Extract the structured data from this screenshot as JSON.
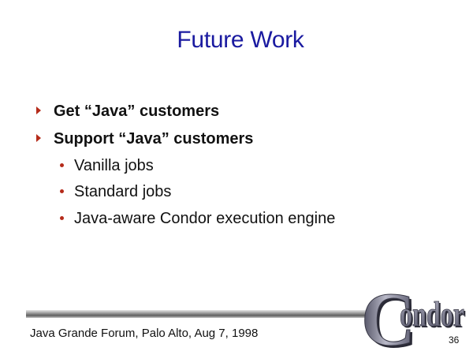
{
  "slide": {
    "title": "Future Work",
    "bullets": [
      {
        "text": "Get “Java” customers"
      },
      {
        "text": "Support “Java” customers"
      }
    ],
    "sub_bullets": [
      {
        "text": "Vanilla jobs"
      },
      {
        "text": "Standard jobs"
      },
      {
        "text": "Java-aware Condor execution engine"
      }
    ],
    "footer": "Java Grande Forum, Palo Alto, Aug 7, 1998",
    "page_number": "36",
    "logo": {
      "C": "C",
      "rest": "ondor"
    }
  },
  "colors": {
    "title": "#1a1aa0",
    "bullet_marker": "#b52b1a",
    "logo_face": "#7a7a8c"
  },
  "icons": {
    "level1_marker": "triangle-right-icon",
    "level2_marker": "dot-icon"
  }
}
